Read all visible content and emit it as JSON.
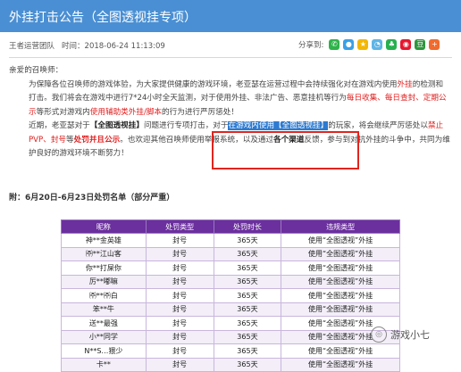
{
  "header": {
    "title": "外挂打击公告（全图透视挂专项）"
  },
  "meta": {
    "author": "王者运营团队",
    "time_label": "时间：",
    "time": "2018-06-24 11:13:09"
  },
  "share": {
    "label": "分享到:",
    "icons": [
      {
        "name": "wechat-icon",
        "color": "#2fb34a"
      },
      {
        "name": "qq-icon",
        "color": "#3aa0e8"
      },
      {
        "name": "qzone-icon",
        "color": "#f2b705"
      },
      {
        "name": "tencent-weibo-icon",
        "color": "#5fb5e6"
      },
      {
        "name": "pengyou-icon",
        "color": "#27b04e"
      },
      {
        "name": "sina-weibo-icon",
        "color": "#e6162d"
      },
      {
        "name": "douban-icon",
        "color": "#2d963d"
      },
      {
        "name": "plus-icon",
        "color": "#f06b2d"
      }
    ]
  },
  "content": {
    "greeting": "亲爱的召唤师：",
    "p1": [
      "为保障各位召唤师的游戏体验，为大家提供健康的游戏环境，老亚瑟在运营过程中会持续强化对在游戏内使用",
      "外挂",
      "的检测和打击。我们将会在游戏中进行7*24小时全天监测，对于使用外挂、非法广告、恶意挂机等行为",
      "每日收集、每日查封、定期公示",
      "等形式对游戏内",
      "使用辅助类外挂/脚本",
      "的行为进行严厉惩处！"
    ],
    "p2": [
      "近期，老亚瑟对于",
      "【全图透视挂】",
      "问题进行专项打击，对于",
      "在游戏内使用【全图透视挂】",
      "的玩家，将会继续严厉惩处以",
      "禁止PVP、封号",
      "等",
      "处罚并且公示",
      "。也欢迎其他召唤师使用举报系统，以及通过",
      "各个渠道",
      "反馈，参与到对抗外挂的斗争中，共同为维护良好的游戏环境不断努力！"
    ],
    "list_title": "附：6月20日-6月23日处罚名单（部分严重）"
  },
  "table": {
    "headers": [
      "昵称",
      "处罚类型",
      "处罚时长",
      "违规类型"
    ],
    "rows": [
      [
        "神**金英雄",
        "封号",
        "365天",
        "使用“全图透视”外挂"
      ],
      [
        "㈜**江山客",
        "封号",
        "365天",
        "使用“全图透视”外挂"
      ],
      [
        "你**打屎你",
        "封号",
        "365天",
        "使用“全图透视”外挂"
      ],
      [
        "厉**嘟嘛",
        "封号",
        "365天",
        "使用“全图透视”外挂"
      ],
      [
        "㈜**㈜白",
        "封号",
        "365天",
        "使用“全图透视”外挂"
      ],
      [
        "笨**牛",
        "封号",
        "365天",
        "使用“全图透视”外挂"
      ],
      [
        "送**最强",
        "封号",
        "365天",
        "使用“全图透视”外挂"
      ],
      [
        "小**同学",
        "封号",
        "365天",
        "使用“全图透视”外挂"
      ],
      [
        "N**S…猥少",
        "封号",
        "365天",
        "使用“全图透视”外挂"
      ],
      [
        "卡**",
        "封号",
        "365天",
        "使用“全图透视”外挂"
      ]
    ]
  },
  "watermark": {
    "text": "游戏小七"
  }
}
